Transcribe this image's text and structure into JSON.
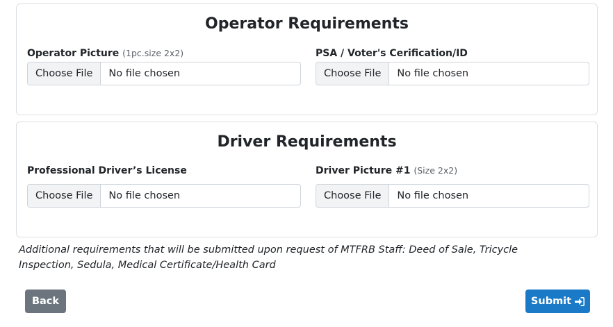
{
  "operator_section": {
    "title": "Operator Requirements",
    "fields": [
      {
        "label": "Operator Picture",
        "hint": "(1pc.size 2x2)",
        "button": "Choose File",
        "status": "No file chosen"
      },
      {
        "label": "PSA / Voter's Cerification/ID",
        "hint": "",
        "button": "Choose File",
        "status": "No file chosen"
      }
    ]
  },
  "driver_section": {
    "title": "Driver Requirements",
    "fields": [
      {
        "label": "Professional Driver’s License",
        "hint": "",
        "button": "Choose File",
        "status": "No file chosen"
      },
      {
        "label": "Driver Picture #1",
        "hint": "(Size 2x2)",
        "button": "Choose File",
        "status": "No file chosen"
      }
    ]
  },
  "note": "Additional requirements that will be submitted upon request of MTFRB Staff: Deed of Sale, Tricycle Inspection, Sedula, Medical Certificate/Health Card",
  "actions": {
    "back_label": "Back",
    "submit_label": "Submit",
    "submit_icon": "sign-in-icon"
  },
  "colors": {
    "back_button": "#6c757d",
    "submit_button": "#1a7ac7"
  }
}
